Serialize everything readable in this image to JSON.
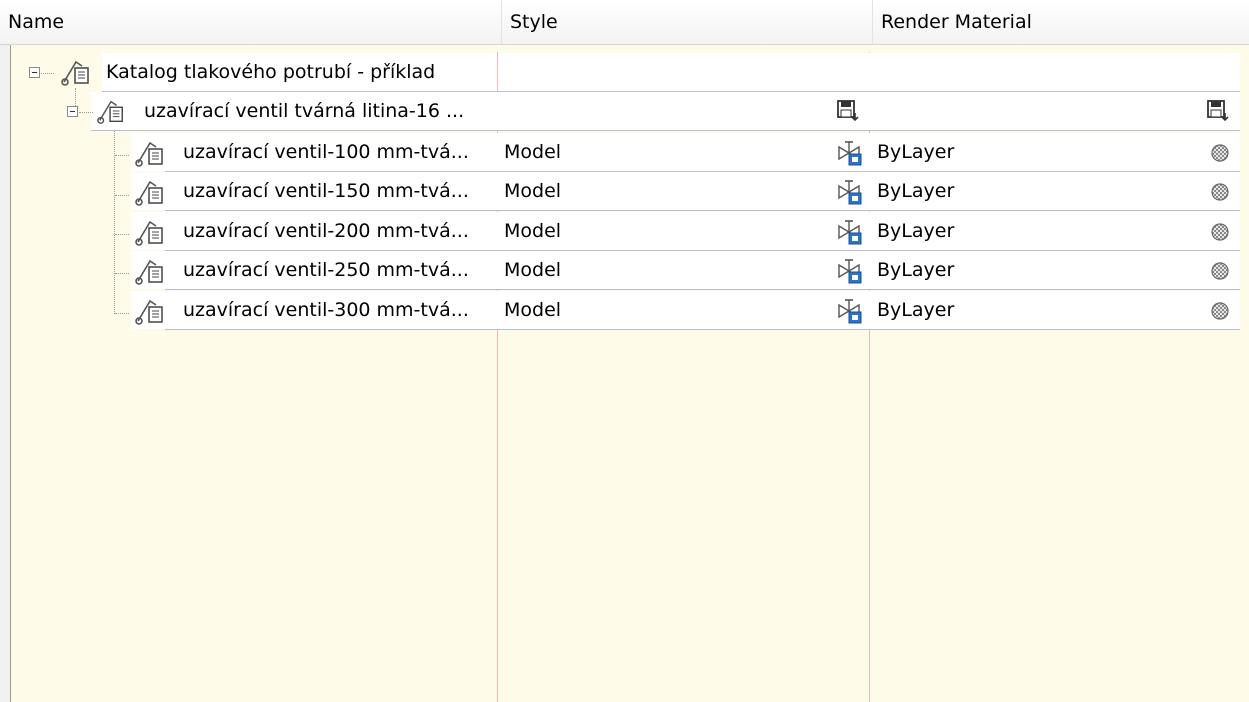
{
  "header": {
    "col_name": "Name",
    "col_style": "Style",
    "col_material": "Render Material"
  },
  "tree": {
    "root": {
      "label": "Katalog tlakového potrubí - příklad",
      "icon": "catalog-icon"
    },
    "group": {
      "label": "uzavírací ventil tvárná litina-16 ...",
      "icon": "catalog-icon",
      "style_icon": "save-icon",
      "material_icon": "save-icon"
    },
    "items": [
      {
        "label": "uzavírací ventil-100 mm-tvá...",
        "style": "Model",
        "material": "ByLayer"
      },
      {
        "label": "uzavírací ventil-150 mm-tvá...",
        "style": "Model",
        "material": "ByLayer"
      },
      {
        "label": "uzavírací ventil-200 mm-tvá...",
        "style": "Model",
        "material": "ByLayer"
      },
      {
        "label": "uzavírací ventil-250 mm-tvá...",
        "style": "Model",
        "material": "ByLayer"
      },
      {
        "label": "uzavírací ventil-300 mm-tvá...",
        "style": "Model",
        "material": "ByLayer"
      }
    ]
  },
  "colors": {
    "background": "#fefbe8",
    "column_separator": "#f4b8b8",
    "row_line": "#b7c0d3"
  }
}
